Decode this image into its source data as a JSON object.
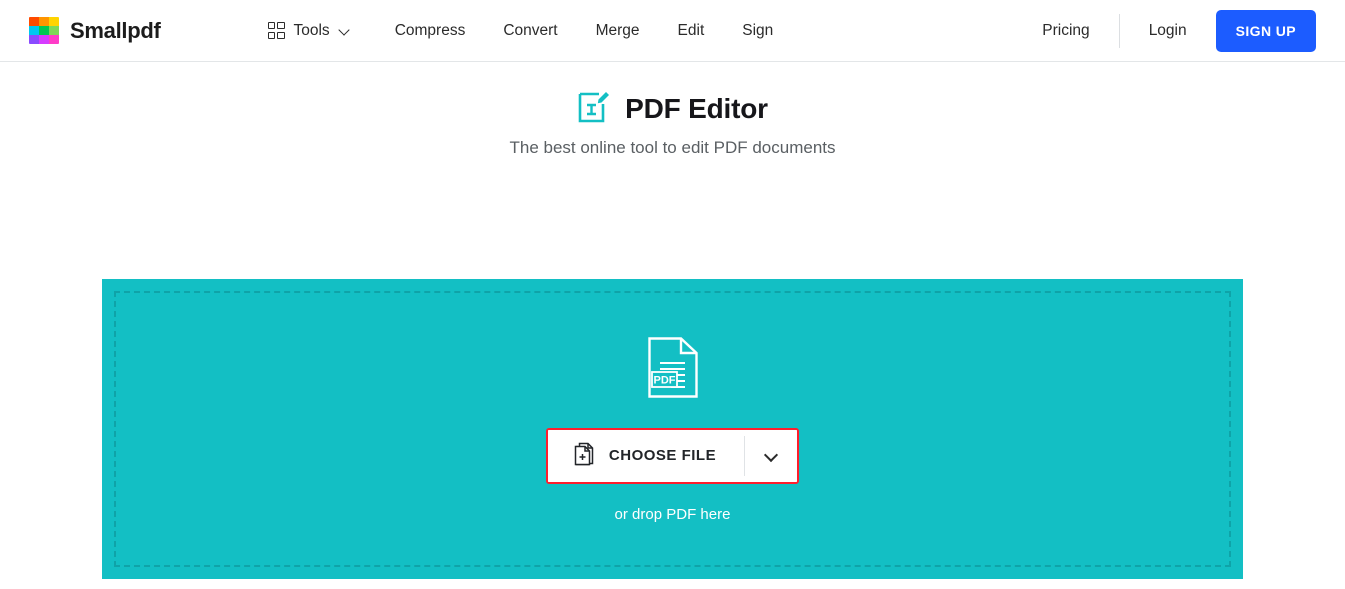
{
  "header": {
    "brand": {
      "name": "Smallpdf",
      "logo_colors": [
        "#ff4b00",
        "#ff9500",
        "#ffd400",
        "#00c8f0",
        "#00c853",
        "#7ed957",
        "#8a4bff",
        "#d63cff",
        "#ff3cc8"
      ]
    },
    "tools": {
      "label": "Tools",
      "icon": "grid-icon",
      "caret": "chevron-down-icon"
    },
    "links": [
      {
        "label": "Compress"
      },
      {
        "label": "Convert"
      },
      {
        "label": "Merge"
      },
      {
        "label": "Edit"
      },
      {
        "label": "Sign"
      }
    ],
    "pricing_label": "Pricing",
    "login_label": "Login",
    "signup_label": "SIGN UP",
    "signup_color": "#1c5cff"
  },
  "hero": {
    "icon": "pdf-editor-icon",
    "icon_color": "#13bfc4",
    "title": "PDF Editor",
    "subtitle": "The best online tool to edit PDF documents"
  },
  "dropzone": {
    "background_color": "#13bfc4",
    "border_style": "dashed",
    "file_icon": "pdf-file-icon",
    "file_icon_badge": "PDF",
    "choose_file_label": "CHOOSE FILE",
    "choose_file_icon": "file-plus-icon",
    "dropdown_icon": "chevron-down-icon",
    "highlight_color": "#ff1e2d",
    "drop_hint": "or drop PDF here"
  }
}
